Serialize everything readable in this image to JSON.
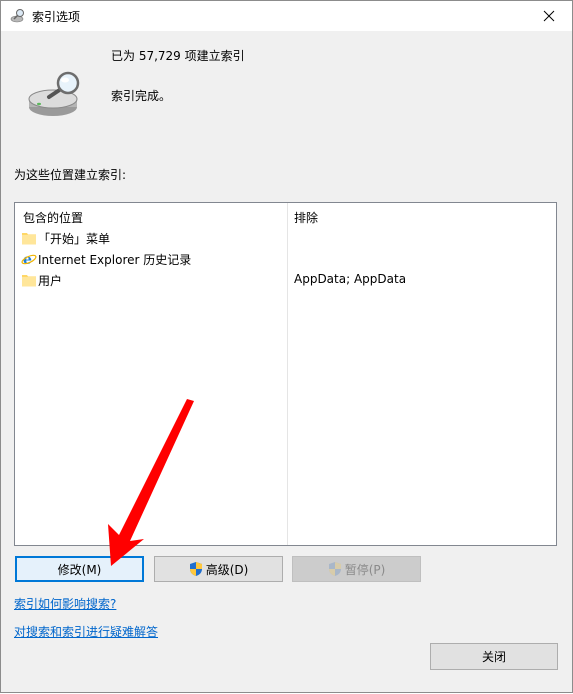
{
  "window": {
    "title": "索引选项"
  },
  "status": {
    "count_text": "已为 57,729 项建立索引",
    "message": "索引完成。"
  },
  "locations": {
    "section_label": "为这些位置建立索引:",
    "headers": {
      "included": "包含的位置",
      "excluded": "排除"
    },
    "rows": [
      {
        "icon": "folder-icon",
        "name": "「开始」菜单",
        "exclude": ""
      },
      {
        "icon": "internet-explorer-icon",
        "name": "Internet Explorer 历史记录",
        "exclude": ""
      },
      {
        "icon": "folder-icon",
        "name": "用户",
        "exclude": "AppData; AppData"
      }
    ]
  },
  "buttons": {
    "modify": "修改(M)",
    "advanced": "高级(D)",
    "pause": "暂停(P)",
    "close": "关闭"
  },
  "links": {
    "how_affects": "索引如何影响搜索?",
    "troubleshoot": "对搜索和索引进行疑难解答"
  },
  "colors": {
    "link": "#0066cc",
    "focus_border": "#0078d7",
    "arrow": "#ff0000"
  }
}
